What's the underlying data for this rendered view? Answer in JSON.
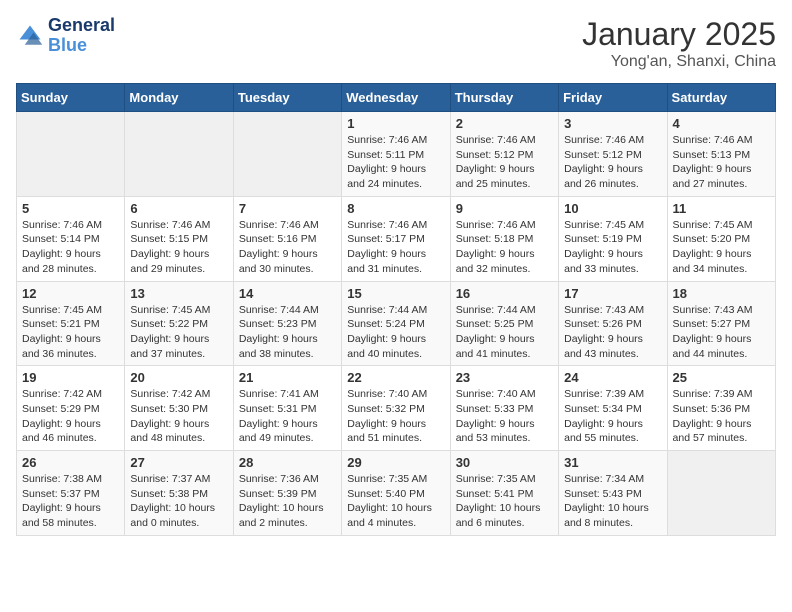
{
  "header": {
    "logo_line1": "General",
    "logo_line2": "Blue",
    "title": "January 2025",
    "subtitle": "Yong'an, Shanxi, China"
  },
  "weekdays": [
    "Sunday",
    "Monday",
    "Tuesday",
    "Wednesday",
    "Thursday",
    "Friday",
    "Saturday"
  ],
  "weeks": [
    [
      {
        "day": null,
        "info": null
      },
      {
        "day": null,
        "info": null
      },
      {
        "day": null,
        "info": null
      },
      {
        "day": "1",
        "info": "Sunrise: 7:46 AM\nSunset: 5:11 PM\nDaylight: 9 hours\nand 24 minutes."
      },
      {
        "day": "2",
        "info": "Sunrise: 7:46 AM\nSunset: 5:12 PM\nDaylight: 9 hours\nand 25 minutes."
      },
      {
        "day": "3",
        "info": "Sunrise: 7:46 AM\nSunset: 5:12 PM\nDaylight: 9 hours\nand 26 minutes."
      },
      {
        "day": "4",
        "info": "Sunrise: 7:46 AM\nSunset: 5:13 PM\nDaylight: 9 hours\nand 27 minutes."
      }
    ],
    [
      {
        "day": "5",
        "info": "Sunrise: 7:46 AM\nSunset: 5:14 PM\nDaylight: 9 hours\nand 28 minutes."
      },
      {
        "day": "6",
        "info": "Sunrise: 7:46 AM\nSunset: 5:15 PM\nDaylight: 9 hours\nand 29 minutes."
      },
      {
        "day": "7",
        "info": "Sunrise: 7:46 AM\nSunset: 5:16 PM\nDaylight: 9 hours\nand 30 minutes."
      },
      {
        "day": "8",
        "info": "Sunrise: 7:46 AM\nSunset: 5:17 PM\nDaylight: 9 hours\nand 31 minutes."
      },
      {
        "day": "9",
        "info": "Sunrise: 7:46 AM\nSunset: 5:18 PM\nDaylight: 9 hours\nand 32 minutes."
      },
      {
        "day": "10",
        "info": "Sunrise: 7:45 AM\nSunset: 5:19 PM\nDaylight: 9 hours\nand 33 minutes."
      },
      {
        "day": "11",
        "info": "Sunrise: 7:45 AM\nSunset: 5:20 PM\nDaylight: 9 hours\nand 34 minutes."
      }
    ],
    [
      {
        "day": "12",
        "info": "Sunrise: 7:45 AM\nSunset: 5:21 PM\nDaylight: 9 hours\nand 36 minutes."
      },
      {
        "day": "13",
        "info": "Sunrise: 7:45 AM\nSunset: 5:22 PM\nDaylight: 9 hours\nand 37 minutes."
      },
      {
        "day": "14",
        "info": "Sunrise: 7:44 AM\nSunset: 5:23 PM\nDaylight: 9 hours\nand 38 minutes."
      },
      {
        "day": "15",
        "info": "Sunrise: 7:44 AM\nSunset: 5:24 PM\nDaylight: 9 hours\nand 40 minutes."
      },
      {
        "day": "16",
        "info": "Sunrise: 7:44 AM\nSunset: 5:25 PM\nDaylight: 9 hours\nand 41 minutes."
      },
      {
        "day": "17",
        "info": "Sunrise: 7:43 AM\nSunset: 5:26 PM\nDaylight: 9 hours\nand 43 minutes."
      },
      {
        "day": "18",
        "info": "Sunrise: 7:43 AM\nSunset: 5:27 PM\nDaylight: 9 hours\nand 44 minutes."
      }
    ],
    [
      {
        "day": "19",
        "info": "Sunrise: 7:42 AM\nSunset: 5:29 PM\nDaylight: 9 hours\nand 46 minutes."
      },
      {
        "day": "20",
        "info": "Sunrise: 7:42 AM\nSunset: 5:30 PM\nDaylight: 9 hours\nand 48 minutes."
      },
      {
        "day": "21",
        "info": "Sunrise: 7:41 AM\nSunset: 5:31 PM\nDaylight: 9 hours\nand 49 minutes."
      },
      {
        "day": "22",
        "info": "Sunrise: 7:40 AM\nSunset: 5:32 PM\nDaylight: 9 hours\nand 51 minutes."
      },
      {
        "day": "23",
        "info": "Sunrise: 7:40 AM\nSunset: 5:33 PM\nDaylight: 9 hours\nand 53 minutes."
      },
      {
        "day": "24",
        "info": "Sunrise: 7:39 AM\nSunset: 5:34 PM\nDaylight: 9 hours\nand 55 minutes."
      },
      {
        "day": "25",
        "info": "Sunrise: 7:39 AM\nSunset: 5:36 PM\nDaylight: 9 hours\nand 57 minutes."
      }
    ],
    [
      {
        "day": "26",
        "info": "Sunrise: 7:38 AM\nSunset: 5:37 PM\nDaylight: 9 hours\nand 58 minutes."
      },
      {
        "day": "27",
        "info": "Sunrise: 7:37 AM\nSunset: 5:38 PM\nDaylight: 10 hours\nand 0 minutes."
      },
      {
        "day": "28",
        "info": "Sunrise: 7:36 AM\nSunset: 5:39 PM\nDaylight: 10 hours\nand 2 minutes."
      },
      {
        "day": "29",
        "info": "Sunrise: 7:35 AM\nSunset: 5:40 PM\nDaylight: 10 hours\nand 4 minutes."
      },
      {
        "day": "30",
        "info": "Sunrise: 7:35 AM\nSunset: 5:41 PM\nDaylight: 10 hours\nand 6 minutes."
      },
      {
        "day": "31",
        "info": "Sunrise: 7:34 AM\nSunset: 5:43 PM\nDaylight: 10 hours\nand 8 minutes."
      },
      {
        "day": null,
        "info": null
      }
    ]
  ]
}
